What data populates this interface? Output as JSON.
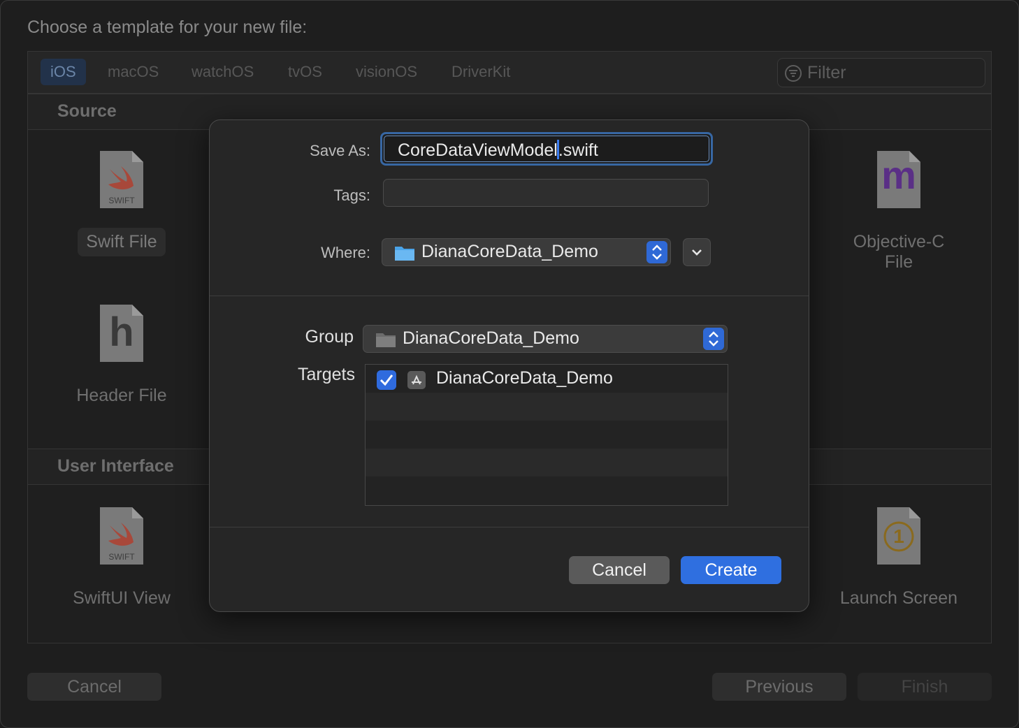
{
  "window": {
    "title": "Choose a template for your new file:"
  },
  "platforms": [
    {
      "label": "iOS",
      "active": true
    },
    {
      "label": "macOS",
      "active": false
    },
    {
      "label": "watchOS",
      "active": false
    },
    {
      "label": "tvOS",
      "active": false
    },
    {
      "label": "visionOS",
      "active": false
    },
    {
      "label": "DriverKit",
      "active": false
    }
  ],
  "filter": {
    "placeholder": "Filter"
  },
  "sections": {
    "source": "Source",
    "user_interface": "User Interface"
  },
  "templates": {
    "swift_file": "Swift File",
    "header_file": "Header File",
    "objc_file": "Objective-C File",
    "swiftui_view": "SwiftUI View",
    "launch_screen": "Launch Screen",
    "swift_icon_caption": "SWIFT",
    "header_icon_glyph": "h",
    "objc_icon_glyph": "m",
    "launch_icon_glyph": "1"
  },
  "footer": {
    "cancel": "Cancel",
    "previous": "Previous",
    "finish": "Finish"
  },
  "sheet": {
    "save_as_label": "Save As:",
    "save_as_before_caret": "CoreDataViewModel",
    "save_as_after_caret": ".swift",
    "tags_label": "Tags:",
    "where_label": "Where:",
    "where_value": "DianaCoreData_Demo",
    "group_label": "Group",
    "group_value": "DianaCoreData_Demo",
    "targets_label": "Targets",
    "targets": [
      {
        "name": "DianaCoreData_Demo",
        "checked": true
      }
    ],
    "cancel": "Cancel",
    "create": "Create"
  },
  "colors": {
    "accent": "#2f6fe0",
    "focus_ring": "#3767a3"
  },
  "icons": {
    "filter": "filter-icon",
    "folder": "folder-icon",
    "stepper": "up-down-chevron-icon",
    "disclosure": "chevron-down-icon",
    "checkbox": "checkmark-icon",
    "app": "app-store-icon"
  }
}
